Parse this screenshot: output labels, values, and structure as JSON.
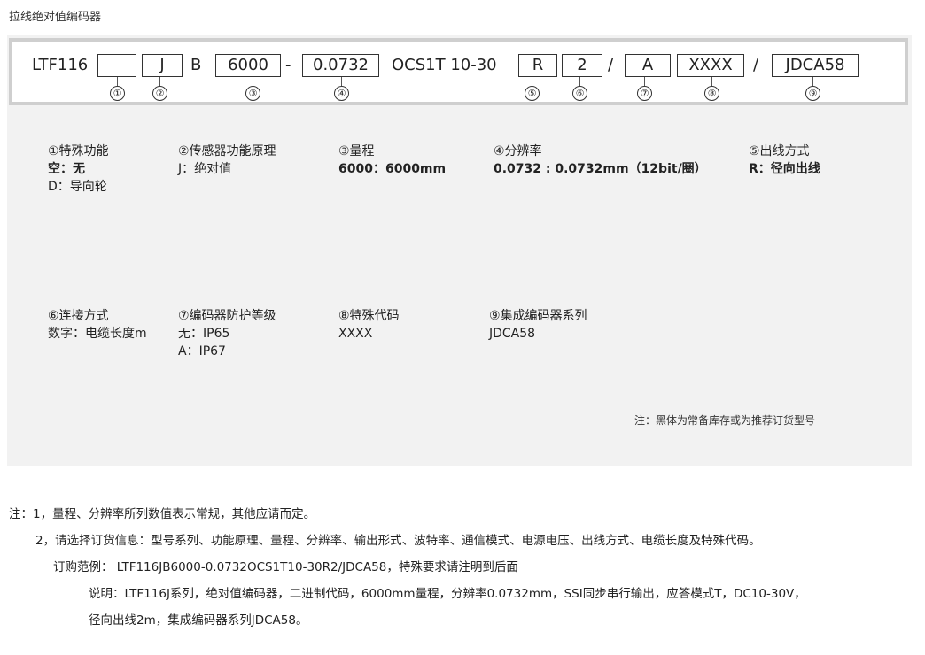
{
  "title": "拉线绝对值编码器",
  "code": {
    "prefix": "LTF116",
    "box1": "",
    "box2": "J",
    "sep_b": "B",
    "box3": "6000",
    "dash": "-",
    "box4": "0.0732",
    "mid": "OCS1T  10-30",
    "box5": "R",
    "box6": "2",
    "slash1": "/",
    "box7": "A",
    "box8": "XXXX",
    "slash2": "/",
    "box9": "JDCA58",
    "nums": [
      "①",
      "②",
      "③",
      "④",
      "⑤",
      "⑥",
      "⑦",
      "⑧",
      "⑨"
    ]
  },
  "row1": [
    {
      "head": "①特殊功能",
      "lines": [
        {
          "t": "空：无",
          "bold": true
        },
        {
          "t": "D：导向轮",
          "bold": false
        }
      ]
    },
    {
      "head": "②传感器功能原理",
      "lines": [
        {
          "t": "J：绝对值",
          "bold": false
        }
      ]
    },
    {
      "head": "③量程",
      "lines": [
        {
          "t": "6000：6000mm",
          "bold": true
        }
      ]
    },
    {
      "head": "④分辨率",
      "lines": [
        {
          "t": "0.0732 : 0.0732mm（12bit/圈）",
          "bold": true
        }
      ]
    },
    {
      "head": "⑤出线方式",
      "lines": [
        {
          "t": "R：径向出线",
          "bold": true
        }
      ]
    }
  ],
  "row2": [
    {
      "head": "⑥连接方式",
      "lines": [
        {
          "t": "数字：电缆长度m",
          "bold": false
        }
      ]
    },
    {
      "head": "⑦编码器防护等级",
      "lines": [
        {
          "t": "无：IP65",
          "bold": false
        },
        {
          "t": "A：IP67",
          "bold": false
        }
      ]
    },
    {
      "head": "⑧特殊代码",
      "lines": [
        {
          "t": "XXXX",
          "bold": false
        }
      ]
    },
    {
      "head": "⑨集成编码器系列",
      "lines": [
        {
          "t": "JDCA58",
          "bold": false
        }
      ]
    }
  ],
  "panel_note": "注：黑体为常备库存或为推荐订货型号",
  "notes": {
    "n1": "注：1，量程、分辨率所列数值表示常规，其他应请而定。",
    "n2": "2，请选择订货信息：型号系列、功能原理、量程、分辨率、输出形式、波特率、通信模式、电源电压、出线方式、电缆长度及特殊代码。",
    "n3": "订购范例：  LTF116JB6000-0.0732OCS1T10-30R2/JDCA58，特殊要求请注明到后面",
    "n4": "说明：LTF116J系列，绝对值编码器，二进制代码，6000mm量程，分辨率0.0732mm，SSI同步串行输出，应答模式T，DC10-30V，",
    "n5": "径向出线2m，集成编码器系列JDCA58。"
  }
}
